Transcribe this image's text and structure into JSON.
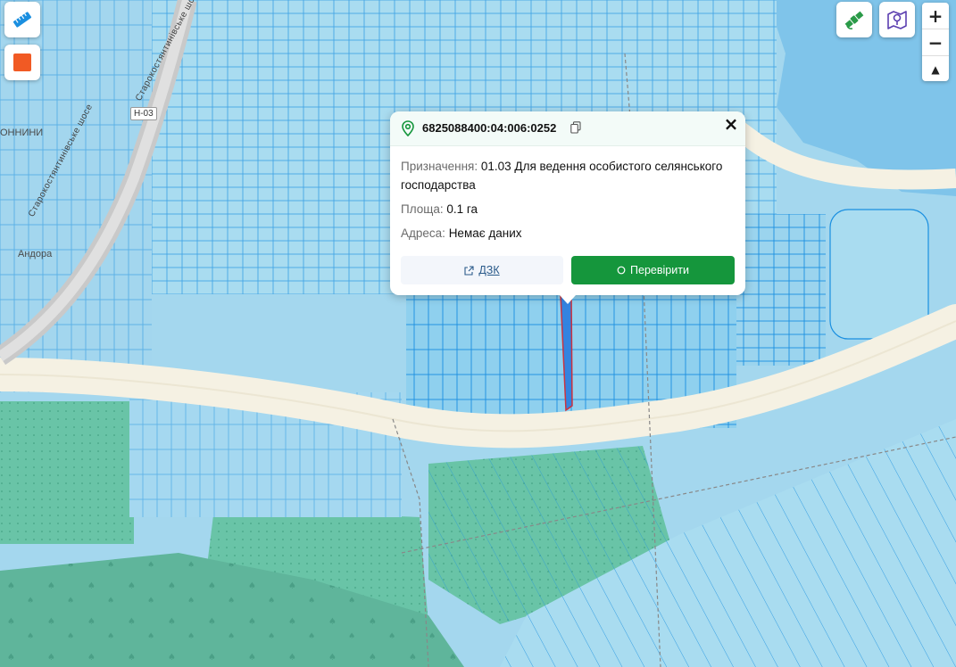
{
  "map": {
    "labels": {
      "road_left": "Старокостянтинівське шосе",
      "road_top": "Старокостянтинівське шосе",
      "route_number": "Н-03",
      "village_left": "ОННИНИ",
      "place_andora": "Андора"
    },
    "colors": {
      "water": "#9fd0ea",
      "parcel_fill": "#a7dbf0",
      "parcel_stroke": "#1a8fe0",
      "agri_fill": "#66c3a6",
      "forest_fill": "#5db49a",
      "road": "#f6f1e4",
      "selected_stroke": "#d02b35"
    }
  },
  "toolbar": {
    "ruler_icon": "ruler-icon",
    "color_swatch_icon": "square-icon",
    "swatch_color": "#f15a24",
    "satellite_icon": "satellite-icon",
    "map_layers_icon": "map-pin-icon"
  },
  "zoom": {
    "in_label": "+",
    "out_label": "−",
    "north_label": "▲"
  },
  "popup": {
    "cadastral_number": "6825088400:04:006:0252",
    "purpose_label": "Призначення:",
    "purpose_value": "01.03 Для ведення особистого селянського господарства",
    "area_label": "Площа:",
    "area_value": "0.1 га",
    "address_label": "Адреса:",
    "address_value": "Немає даних",
    "dzk_label": "ДЗК",
    "check_label": "Перевірити"
  }
}
